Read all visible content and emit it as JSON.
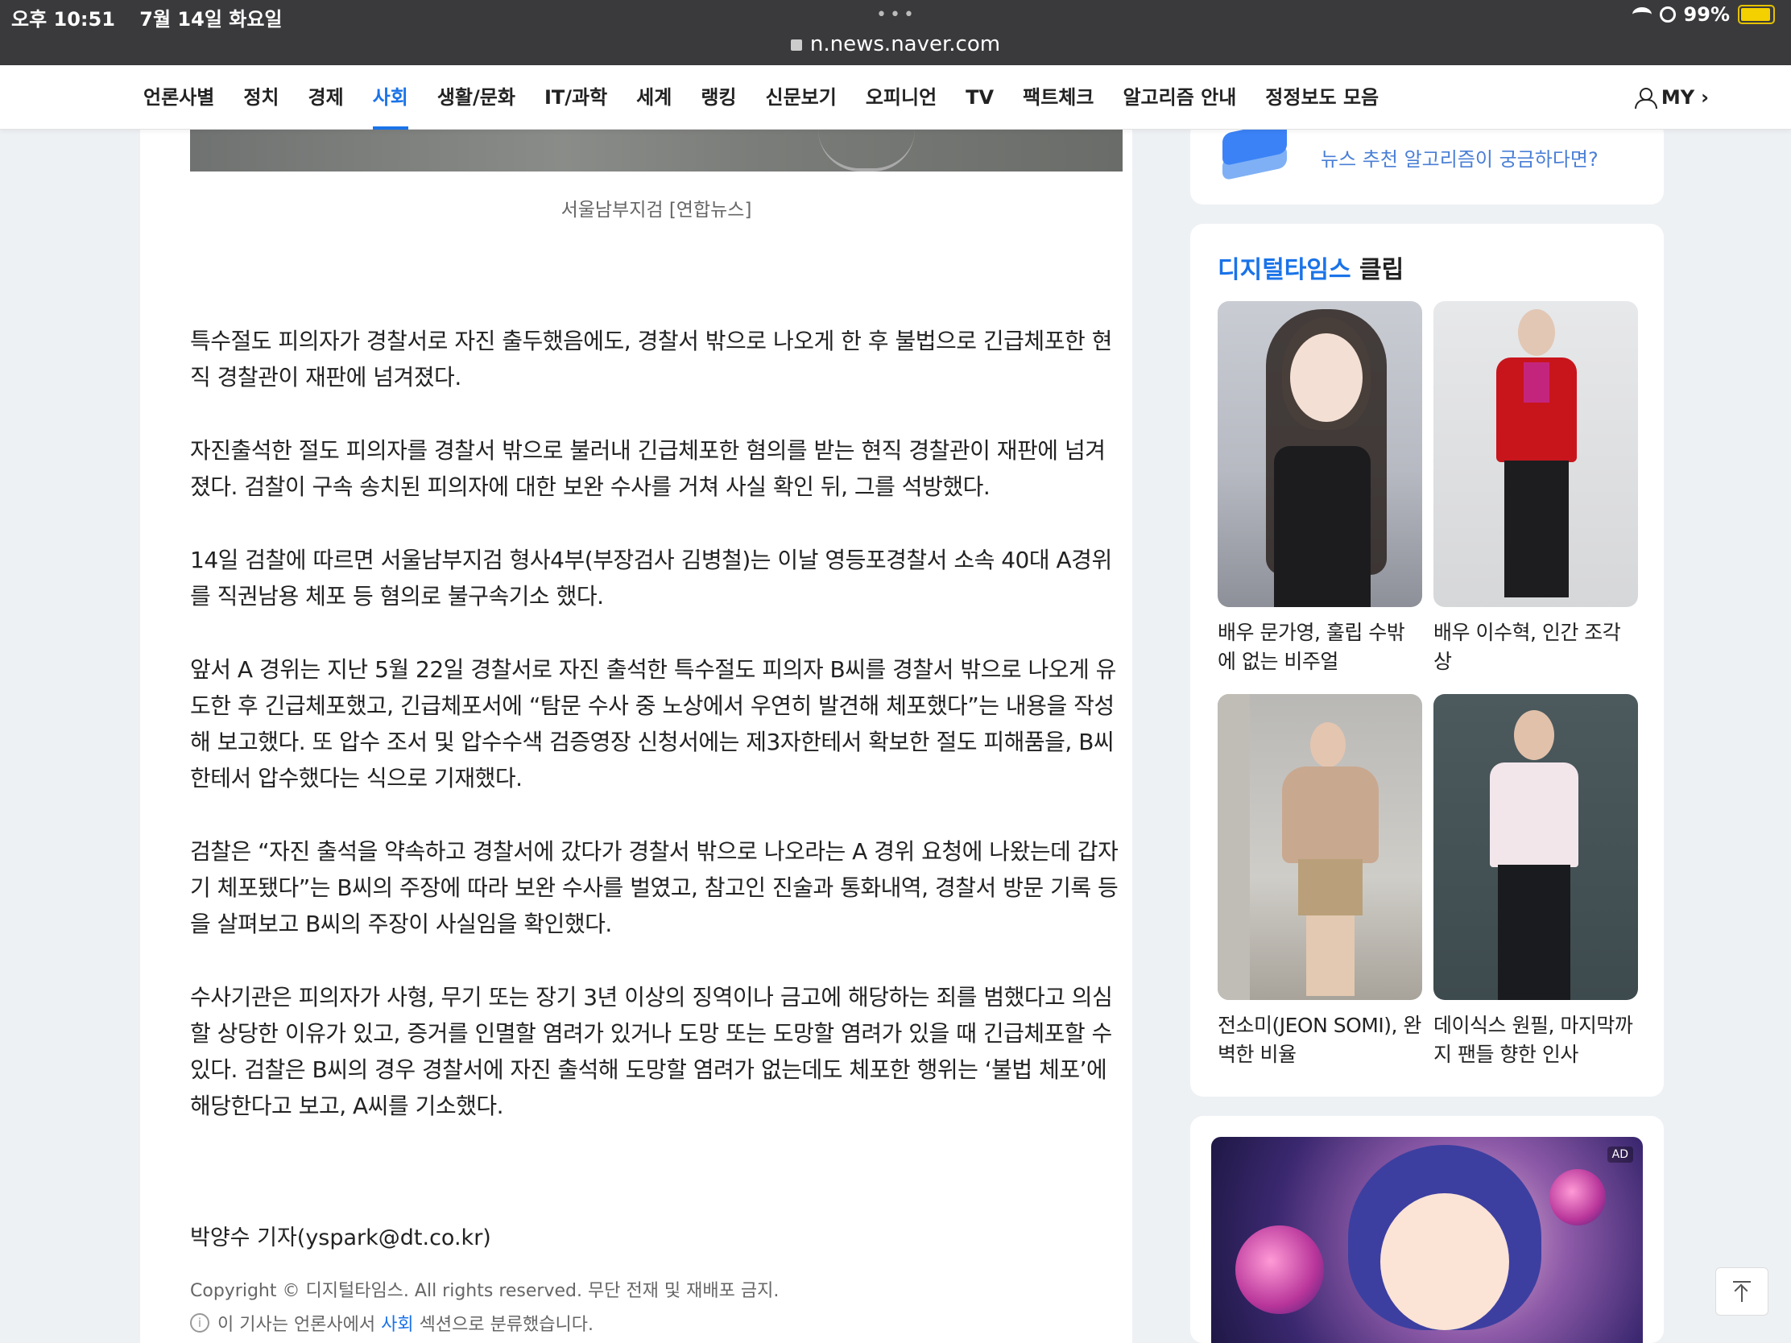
{
  "status_bar": {
    "time": "오후 10:51",
    "date": "7월 14일 화요일",
    "battery": "99%",
    "url": "n.news.naver.com"
  },
  "nav": {
    "items": [
      "언론사별",
      "정치",
      "경제",
      "사회",
      "생활/문화",
      "IT/과학",
      "세계",
      "랭킹",
      "신문보기",
      "오피니언",
      "TV",
      "팩트체크",
      "알고리즘 안내",
      "정정보도 모음"
    ],
    "active": "사회",
    "my_label": "MY",
    "my_chevron": "›"
  },
  "article": {
    "caption": "서울남부지검 [연합뉴스]",
    "paragraphs": [
      "특수절도 피의자가 경찰서로 자진 출두했음에도, 경찰서 밖으로 나오게 한 후 불법으로 긴급체포한 현직 경찰관이 재판에 넘겨졌다.",
      "자진출석한 절도 피의자를 경찰서 밖으로 불러내 긴급체포한 혐의를 받는 현직 경찰관이 재판에 넘겨졌다. 검찰이 구속 송치된 피의자에 대한 보완 수사를 거쳐 사실 확인 뒤, 그를 석방했다.",
      "14일 검찰에 따르면 서울남부지검 형사4부(부장검사 김병철)는 이날 영등포경찰서 소속 40대 A경위를 직권남용 체포 등 혐의로 불구속기소 했다.",
      "앞서 A 경위는 지난 5월 22일 경찰서로 자진 출석한 특수절도 피의자 B씨를 경찰서 밖으로 나오게 유도한 후 긴급체포했고, 긴급체포서에 “탐문 수사 중 노상에서 우연히 발견해 체포했다”는 내용을 작성해 보고했다. 또 압수 조서 및 압수수색 검증영장 신청서에는 제3자한테서 확보한 절도 피해품을, B씨한테서 압수했다는 식으로 기재했다.",
      "검찰은 “자진 출석을 약속하고 경찰서에 갔다가 경찰서 밖으로 나오라는 A 경위 요청에 나왔는데 갑자기 체포됐다”는 B씨의 주장에 따라 보완 수사를 벌였고, 참고인 진술과 통화내역, 경찰서 방문 기록 등을 살펴보고 B씨의 주장이 사실임을 확인했다.",
      "수사기관은 피의자가 사형, 무기 또는 장기 3년 이상의 징역이나 금고에 해당하는 죄를 범했다고 의심할 상당한 이유가 있고, 증거를 인멸할 염려가 있거나 도망 또는 도망할 염려가 있을 때 긴급체포할 수 있다. 검찰은 B씨의 경우 경찰서에 자진 출석해 도망할 염려가 없는데도 체포한 행위는 ‘불법 체포’에 해당한다고 보고, A씨를 기소했다."
    ],
    "byline": "박양수 기자(yspark@dt.co.kr)",
    "copyright": "Copyright © 디지털타임스. All rights reserved. 무단 전재 및 재배포 금지.",
    "classify_prefix": "이 기사는 언론사에서 ",
    "classify_section": "사회",
    "classify_suffix": " 섹션으로 분류했습니다."
  },
  "sidebar": {
    "algo_text": "뉴스 추천 알고리즘이 궁금하다면?",
    "clip_brand": "디지털타임스",
    "clip_word": " 클립",
    "clips": [
      {
        "title": "배우 문가영, 훌립 수밖에 없는 비주얼"
      },
      {
        "title": "배우 이수혁, 인간 조각상"
      },
      {
        "title": "전소미(JEON SOMI), 완벽한 비율"
      },
      {
        "title": "데이식스 원필, 마지막까지 팬들 향한 인사"
      }
    ],
    "ad_badge": "AD"
  },
  "colors": {
    "accent": "#1a73e8",
    "status_bg": "#3a3a3c"
  }
}
